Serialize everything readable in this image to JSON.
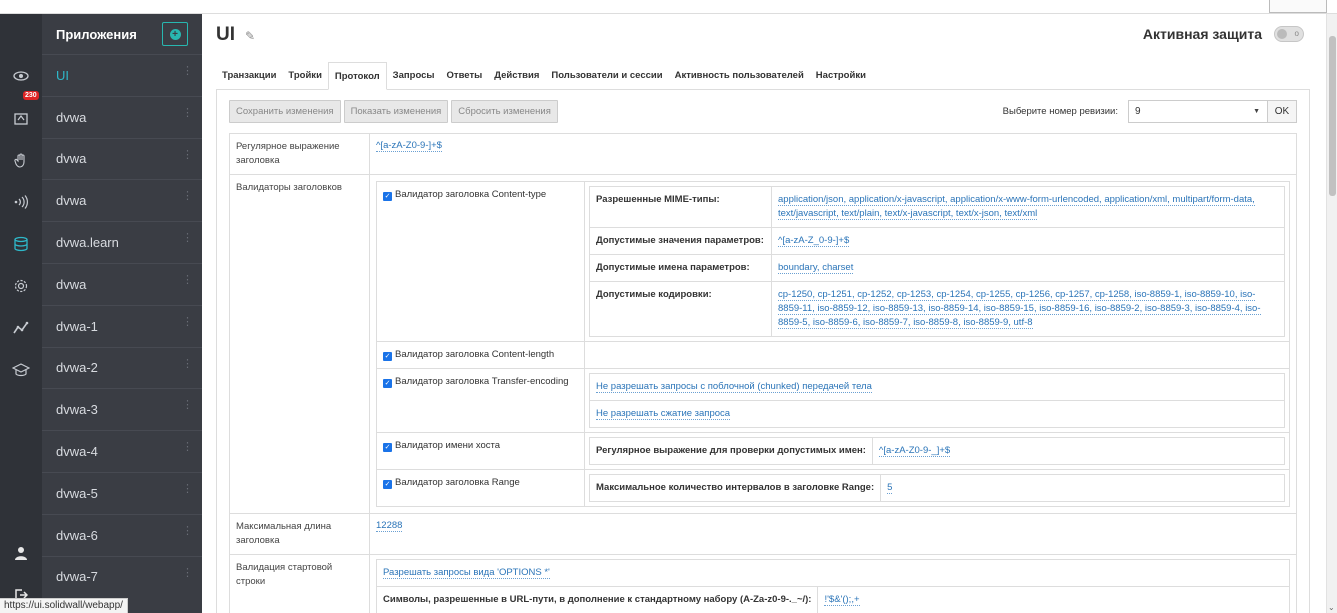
{
  "icons": {
    "eye": "eye-icon",
    "alerts": "alert-box-icon",
    "hand": "hand-icon",
    "sound": "signal-icon",
    "db": "database-icon",
    "gear": "gear-icon",
    "graph": "graph-icon",
    "cap": "graduation-cap-icon",
    "user": "user-icon",
    "logout": "logout-icon"
  },
  "rail": {
    "alert_count": "230"
  },
  "apps": {
    "title": "Приложения",
    "items": [
      "UI",
      "dvwa",
      "dvwa",
      "dvwa",
      "dvwa.learn",
      "dvwa",
      "dvwa-1",
      "dvwa-2",
      "dvwa-3",
      "dvwa-4",
      "dvwa-5",
      "dvwa-6",
      "dvwa-7"
    ]
  },
  "header": {
    "title": "UI",
    "protection_label": "Активная защита"
  },
  "tabs": [
    "Транзакции",
    "Тройки",
    "Протокол",
    "Запросы",
    "Ответы",
    "Действия",
    "Пользователи и сессии",
    "Активность пользователей",
    "Настройки"
  ],
  "toolbar": {
    "save": "Сохранить изменения",
    "show": "Показать изменения",
    "reset": "Сбросить изменения",
    "revision_label": "Выберите номер ревизии:",
    "revision_value": "9",
    "ok": "OK"
  },
  "settings": {
    "header_regex_label": "Регулярное выражение заголовка",
    "header_regex_value": "^[a-zA-Z0-9-]+$",
    "validators_label": "Валидаторы заголовков",
    "ct_validator": "Валидатор заголовка Content-type",
    "mime_label": "Разрешенные MIME-типы:",
    "mime_value": "application/json, application/x-javascript, application/x-www-form-urlencoded, application/xml, multipart/form-data, text/javascript, text/plain, text/x-javascript, text/x-json, text/xml",
    "param_values_label": "Допустимые значения параметров:",
    "param_values_value": "^[a-zA-Z_0-9-]+$",
    "param_names_label": "Допустимые имена параметров:",
    "param_names_value": "boundary, charset",
    "encodings_label": "Допустимые кодировки:",
    "encodings_value": "cp-1250, cp-1251, cp-1252, cp-1253, cp-1254, cp-1255, cp-1256, cp-1257, cp-1258, iso-8859-1, iso-8859-10, iso-8859-11, iso-8859-12, iso-8859-13, iso-8859-14, iso-8859-15, iso-8859-16, iso-8859-2, iso-8859-3, iso-8859-4, iso-8859-5, iso-8859-6, iso-8859-7, iso-8859-8, iso-8859-9, utf-8",
    "cl_validator": "Валидатор заголовка Content-length",
    "te_validator": "Валидатор заголовка Transfer-encoding",
    "te_opt1": "Не разрешать запросы с поблочной (chunked) передачей тела",
    "te_opt2": "Не разрешать сжатие запроса",
    "host_validator": "Валидатор имени хоста",
    "host_regex_label": "Регулярное выражение для проверки допустимых имен:",
    "host_regex_value": "^[a-zA-Z0-9-_]+$",
    "range_validator": "Валидатор заголовка Range",
    "range_label": "Максимальное количество интервалов в заголовке Range:",
    "range_value": "5",
    "max_header_label": "Максимальная длина заголовка",
    "max_header_value": "12288",
    "start_line_label": "Валидация стартовой строки",
    "options_value": "Разрешать запросы вида 'OPTIONS *'",
    "url_chars_label": "Символы, разрешенные в URL-пути, в дополнение к стандартному набору (A-Za-z0-9-._~/):",
    "url_chars_value": "!'$&'();,+"
  },
  "status_url": "https://ui.solidwall/webapp/"
}
